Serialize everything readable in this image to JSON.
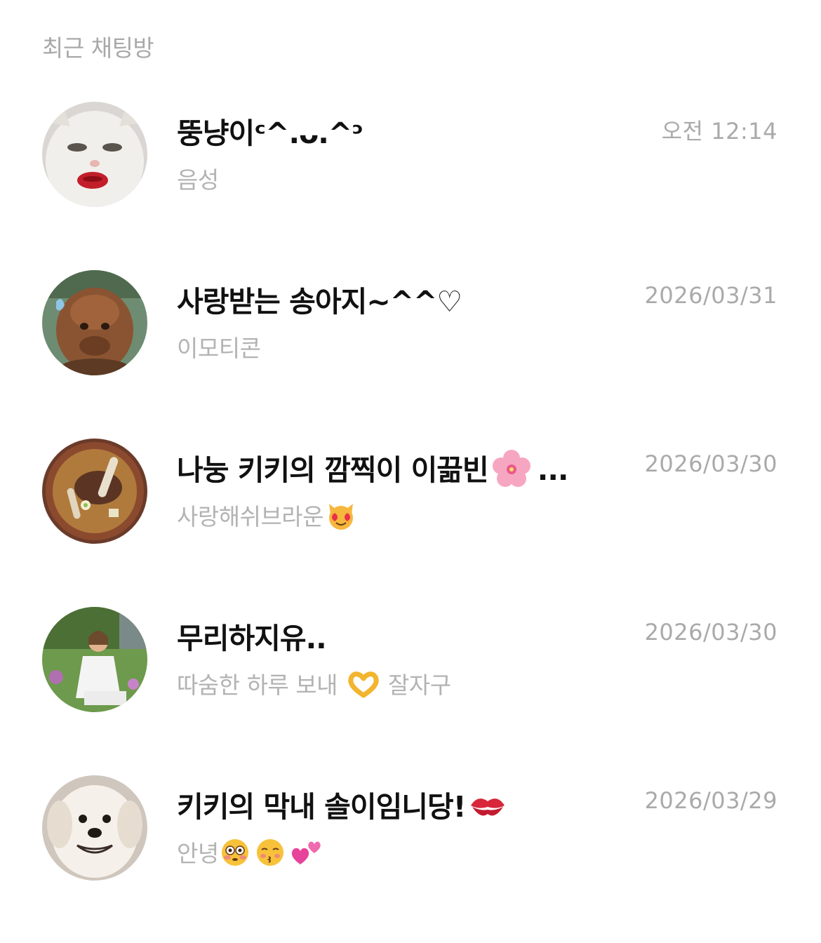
{
  "header": {
    "title": "최근 채팅방"
  },
  "chats": [
    {
      "name": "뚱냥이ᶜ^.ᴗ.^ᵓ",
      "preview": "음성",
      "time": "오전 12:14",
      "avatar": "white-cat-with-red-lips-photo"
    },
    {
      "name": "사랑받는 송아지~^^♡",
      "preview": "이모티콘",
      "time": "2026/03/31",
      "avatar": "brown-highland-calf-photo"
    },
    {
      "name": "나눙 키키의 깜찍이 이끎빈",
      "name_suffix": "...",
      "name_icon": "cherry-blossom-icon",
      "preview": "사랑해쉬브라운",
      "preview_icon": "heart-eyes-cat-icon",
      "time": "2026/03/30",
      "avatar": "galbitang-soup-photo"
    },
    {
      "name": "무리하지유..",
      "preview": "따숨한 하루 보내",
      "preview_icon": "heart-hands-icon",
      "preview_suffix": "잘자구",
      "time": "2026/03/30",
      "avatar": "person-in-garden-photo"
    },
    {
      "name": "키키의 막내 솔이임니당!",
      "name_icon": "kiss-mark-icon",
      "preview": "안녕",
      "preview_icons": [
        "flushed-face-icon",
        "kissing-face-icon",
        "two-hearts-icon"
      ],
      "time": "2026/03/29",
      "avatar": "smiling-white-dog-photo"
    }
  ]
}
